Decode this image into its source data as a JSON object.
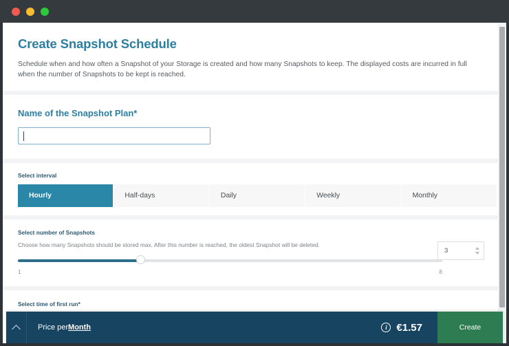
{
  "window": {
    "controls": [
      "close",
      "minimize",
      "maximize"
    ]
  },
  "header": {
    "title": "Create Snapshot Schedule",
    "description": "Schedule when and how often a Snapshot of your Storage is created and how many Snapshots to keep. The displayed costs are incurred in full when the number of Snapshots to be kept is reached."
  },
  "name_field": {
    "label": "Name of the Snapshot Plan*",
    "value": "",
    "placeholder": "",
    "focused": true
  },
  "interval": {
    "label": "Select interval",
    "options": [
      {
        "label": "Hourly",
        "active": true
      },
      {
        "label": "Half-days",
        "active": false
      },
      {
        "label": "Daily",
        "active": false
      },
      {
        "label": "Weekly",
        "active": false
      },
      {
        "label": "Monthly",
        "active": false
      }
    ]
  },
  "snapshots": {
    "label": "Select number of Snapshots",
    "help": "Choose how many Snapshots should be stored max. After this number is reached, the oldest Snapshot will be deleted.",
    "slider_min": "1",
    "slider_max": "8",
    "value": "3",
    "spin_up_icon": "chevron-up-icon",
    "spin_down_icon": "chevron-down-icon"
  },
  "first_run": {
    "label": "Select time of first run*"
  },
  "footer": {
    "collapse_icon": "chevron-up-icon",
    "price_prefix": "Price per ",
    "price_period": "Month",
    "info_icon": "info-icon",
    "info_glyph": "i",
    "amount": "€1.57",
    "create_label": "Create",
    "create_color": "#2e7d52",
    "bar_color": "#174461"
  },
  "colors": {
    "accent": "#2c7ea1",
    "tab_active": "#2a87a8",
    "slider_fill": "#2c6e8c"
  }
}
